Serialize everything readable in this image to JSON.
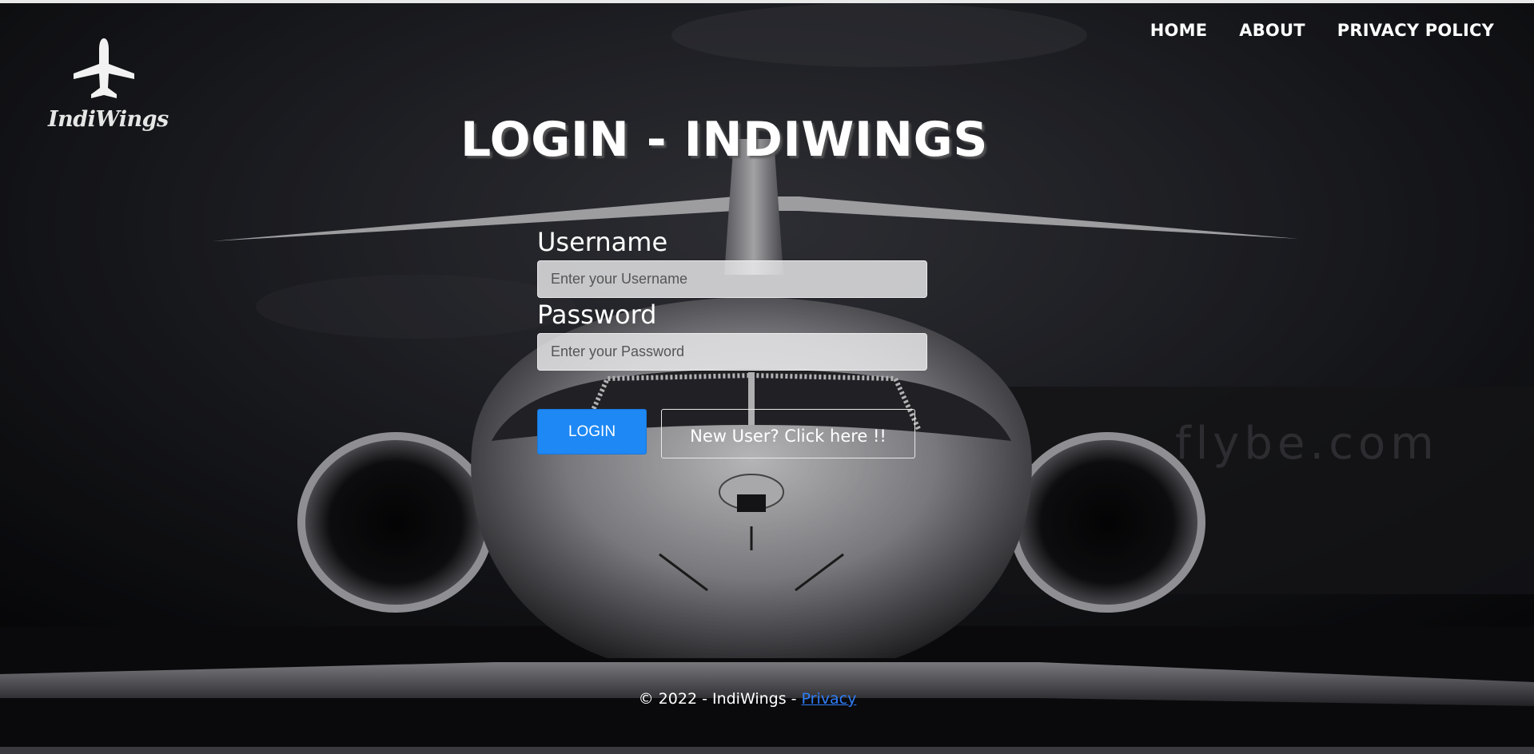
{
  "brand": {
    "name": "IndiWings",
    "logo_icon": "airplane-icon"
  },
  "nav": {
    "items": [
      "HOME",
      "ABOUT",
      "PRIVACY POLICY"
    ]
  },
  "page": {
    "title": "LOGIN - INDIWINGS"
  },
  "form": {
    "username_label": "Username",
    "username_placeholder": "Enter your Username",
    "password_label": "Password",
    "password_placeholder": "Enter your Password",
    "login_button": "LOGIN",
    "new_user_button": "New User? Click here !!"
  },
  "footer": {
    "copyright": "© 2022 - IndiWings - ",
    "privacy_link": "Privacy"
  },
  "colors": {
    "primary_button": "#1e88f5",
    "link": "#2f7df6",
    "text": "#ffffff"
  }
}
